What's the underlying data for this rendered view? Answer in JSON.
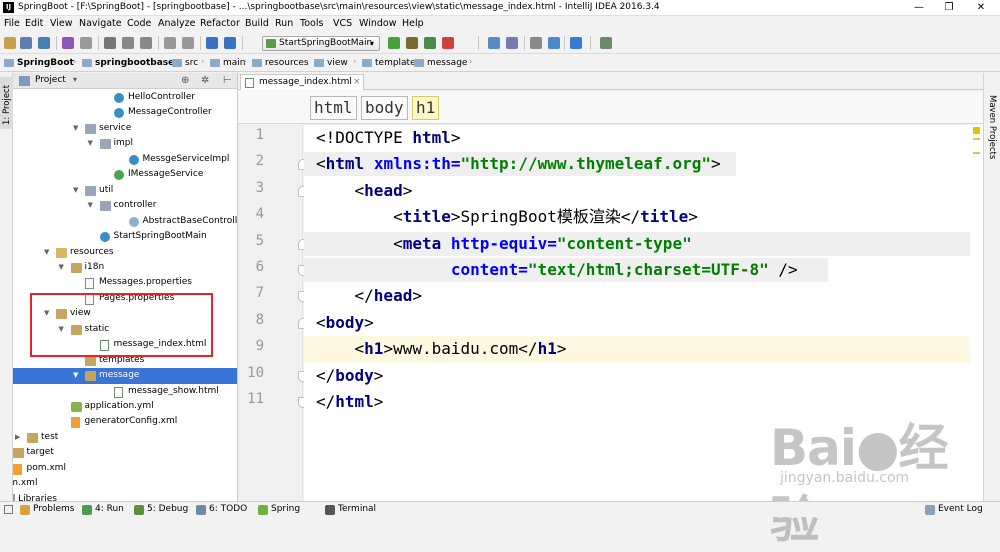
{
  "window": {
    "title": "SpringBoot - [F:\\SpringBoot] - [springbootbase] - ...\\springbootbase\\src\\main\\resources\\view\\static\\message_index.html - IntelliJ IDEA 2016.3.4",
    "app_icon": "IJ",
    "minimize": "—",
    "maximize": "❐",
    "close": "✕"
  },
  "menu": [
    "File",
    "Edit",
    "View",
    "Navigate",
    "Code",
    "Analyze",
    "Refactor",
    "Build",
    "Run",
    "Tools",
    "VCS",
    "Window",
    "Help"
  ],
  "toolbar": {
    "run_config": "StartSpringBootMain",
    "icons": [
      "open-icon",
      "save-icon",
      "sync-icon",
      "undo-icon",
      "redo-icon",
      "cut-icon",
      "copy-icon",
      "paste-icon",
      "find-icon",
      "replace-icon",
      "back-icon",
      "forward-icon",
      "run-icon",
      "debug-icon",
      "coverage-icon",
      "stop-icon",
      "build-icon",
      "structure-icon",
      "settings-icon",
      "project-structure-icon",
      "help-icon",
      "vcs-icon"
    ]
  },
  "breadcrumbs": [
    "SpringBoot",
    "springbootbase",
    "src",
    "main",
    "resources",
    "view",
    "templates",
    "message"
  ],
  "side_tabs": {
    "left": "1: Project",
    "right": "Maven Projects"
  },
  "project_panel": {
    "header": "Project",
    "tree": [
      {
        "label": "HelloController",
        "icon": "class",
        "depth": 6,
        "arrow": ""
      },
      {
        "label": "MessageController",
        "icon": "class",
        "depth": 6,
        "arrow": ""
      },
      {
        "label": "service",
        "icon": "pkg",
        "depth": 4,
        "arrow": "▼"
      },
      {
        "label": "impl",
        "icon": "pkg",
        "depth": 5,
        "arrow": "▼"
      },
      {
        "label": "MessgeServiceImpl",
        "icon": "class",
        "depth": 7,
        "arrow": ""
      },
      {
        "label": "IMessageService",
        "icon": "iface",
        "depth": 6,
        "arrow": ""
      },
      {
        "label": "util",
        "icon": "pkg",
        "depth": 4,
        "arrow": "▼"
      },
      {
        "label": "controller",
        "icon": "pkg",
        "depth": 5,
        "arrow": "▼"
      },
      {
        "label": "AbstractBaseController",
        "icon": "abs",
        "depth": 7,
        "arrow": ""
      },
      {
        "label": "StartSpringBootMain",
        "icon": "class",
        "depth": 5,
        "arrow": ""
      },
      {
        "label": "resources",
        "icon": "res",
        "depth": 2,
        "arrow": "▼"
      },
      {
        "label": "i18n",
        "icon": "folder",
        "depth": 3,
        "arrow": "▼"
      },
      {
        "label": "Messages.properties",
        "icon": "file",
        "depth": 4,
        "arrow": ""
      },
      {
        "label": "Pages.properties",
        "icon": "file",
        "depth": 4,
        "arrow": ""
      },
      {
        "label": "view",
        "icon": "folder",
        "depth": 2,
        "arrow": "▼"
      },
      {
        "label": "static",
        "icon": "folder",
        "depth": 3,
        "arrow": "▼"
      },
      {
        "label": "message_index.html",
        "icon": "html",
        "depth": 5,
        "arrow": ""
      },
      {
        "label": "templates",
        "icon": "folder",
        "depth": 4,
        "arrow": ""
      },
      {
        "label": "message",
        "icon": "folder",
        "depth": 4,
        "arrow": "▼",
        "selected": true
      },
      {
        "label": "message_show.html",
        "icon": "html",
        "depth": 6,
        "arrow": ""
      },
      {
        "label": "application.yml",
        "icon": "yml",
        "depth": 3,
        "arrow": ""
      },
      {
        "label": "generatorConfig.xml",
        "icon": "xml",
        "depth": 3,
        "arrow": ""
      },
      {
        "label": "test",
        "icon": "folder",
        "depth": 0,
        "arrow": "▶"
      },
      {
        "label": "target",
        "icon": "folder",
        "depth": -1,
        "arrow": ""
      },
      {
        "label": "pom.xml",
        "icon": "xml",
        "depth": -1,
        "arrow": ""
      },
      {
        "label": "pom.xml",
        "icon": "",
        "depth": -2,
        "arrow": ""
      },
      {
        "label": "rnal Libraries",
        "icon": "",
        "depth": -2,
        "arrow": ""
      }
    ]
  },
  "editor": {
    "tab_label": "message_index.html",
    "tab_close": "×",
    "tag_breadcrumbs": [
      "html",
      "body",
      "h1"
    ],
    "line_numbers": [
      "1",
      "2",
      "3",
      "4",
      "5",
      "6",
      "7",
      "8",
      "9",
      "10",
      "11"
    ],
    "lines": [
      [
        [
          "tx",
          "<!DOCTYPE "
        ],
        [
          "tg",
          "html"
        ],
        [
          "tx",
          ">"
        ]
      ],
      [
        [
          "tx",
          "<"
        ],
        [
          "tg",
          "html "
        ],
        [
          "at",
          "xmlns:th="
        ],
        [
          "st",
          "\"http://www.thymeleaf.org\""
        ],
        [
          "tx",
          ">"
        ]
      ],
      [
        [
          "tx",
          "    <"
        ],
        [
          "tg",
          "head"
        ],
        [
          "tx",
          ">"
        ]
      ],
      [
        [
          "tx",
          "        <"
        ],
        [
          "tg",
          "title"
        ],
        [
          "tx",
          ">SpringBoot模板渲染</"
        ],
        [
          "tg",
          "title"
        ],
        [
          "tx",
          ">"
        ]
      ],
      [
        [
          "tx",
          "        <"
        ],
        [
          "tg",
          "meta "
        ],
        [
          "at",
          "http-equiv="
        ],
        [
          "st",
          "\"content-type\""
        ]
      ],
      [
        [
          "tx",
          "              "
        ],
        [
          "at",
          "content="
        ],
        [
          "st",
          "\"text/html;charset=UTF-8\""
        ],
        [
          "tx",
          " />"
        ]
      ],
      [
        [
          "tx",
          "    </"
        ],
        [
          "tg",
          "head"
        ],
        [
          "tx",
          ">"
        ]
      ],
      [
        [
          "tx",
          "<"
        ],
        [
          "tg",
          "body"
        ],
        [
          "tx",
          ">"
        ]
      ],
      [
        [
          "tx",
          "    <"
        ],
        [
          "tg",
          "h1"
        ],
        [
          "tx",
          ">www.baidu.com</"
        ],
        [
          "tg",
          "h1"
        ],
        [
          "tx",
          ">"
        ]
      ],
      [
        [
          "tx",
          "</"
        ],
        [
          "tg",
          "body"
        ],
        [
          "tx",
          ">"
        ]
      ],
      [
        [
          "tx",
          "</"
        ],
        [
          "tg",
          "html"
        ],
        [
          "tx",
          ">"
        ]
      ]
    ],
    "current_line": 9
  },
  "watermark": {
    "big": "Bai●经验",
    "small": "jingyan.baidu.com"
  },
  "statusbar": [
    {
      "label": "Problems",
      "icon": "problems-icon",
      "color": "#d9a13a"
    },
    {
      "label": "4: Run",
      "icon": "run-icon",
      "color": "#4c9a4c"
    },
    {
      "label": "5: Debug",
      "icon": "debug-icon",
      "color": "#5b8f3c"
    },
    {
      "label": "6: TODO",
      "icon": "todo-icon",
      "color": "#6f8aa6"
    },
    {
      "label": "Spring",
      "icon": "spring-icon",
      "color": "#6db33f"
    },
    {
      "label": "Terminal",
      "icon": "terminal-icon",
      "color": "#555555"
    },
    {
      "label": "Event Log",
      "icon": "event-log-icon",
      "color": "#8aa0b8"
    }
  ],
  "colors": {
    "selection": "#3875d6",
    "annotation_box": "#e8232b",
    "tag": "#000080",
    "attribute": "#0000ff",
    "string": "#008000"
  }
}
